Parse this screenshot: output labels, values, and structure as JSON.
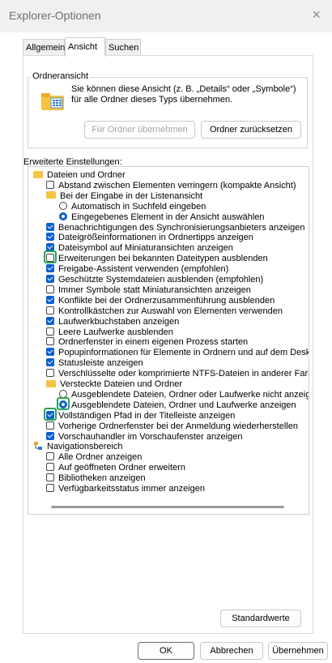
{
  "window": {
    "title": "Explorer-Optionen",
    "close_symbol": "×"
  },
  "tabs": [
    {
      "label": "Allgemein",
      "active": false
    },
    {
      "label": "Ansicht",
      "active": true
    },
    {
      "label": "Suchen",
      "active": false
    }
  ],
  "folder_view": {
    "legend": "Ordneransicht",
    "description": "Sie können diese Ansicht (z. B. „Details“ oder „Symbole“) für alle Ordner dieses Typs übernehmen.",
    "apply_label": "Für Ordner übernehmen",
    "reset_label": "Ordner zurücksetzen"
  },
  "advanced": {
    "label": "Erweiterte Einstellungen:",
    "items": [
      {
        "kind": "folder",
        "level": 0,
        "label": "Dateien und Ordner"
      },
      {
        "kind": "checkbox",
        "level": 1,
        "checked": false,
        "label": "Abstand zwischen Elementen verringern (kompakte Ansicht)"
      },
      {
        "kind": "folder",
        "level": 1,
        "label": "Bei der Eingabe in der Listenansicht"
      },
      {
        "kind": "radio",
        "level": 2,
        "checked": false,
        "label": "Automatisch in Suchfeld eingeben"
      },
      {
        "kind": "radio",
        "level": 2,
        "checked": true,
        "label": "Eingegebenes Element in der Ansicht auswählen"
      },
      {
        "kind": "checkbox",
        "level": 1,
        "checked": true,
        "label": "Benachrichtigungen des Synchronisierungsanbieters anzeigen"
      },
      {
        "kind": "checkbox",
        "level": 1,
        "checked": true,
        "label": "Dateigrößeinformationen in Ordnertipps anzeigen"
      },
      {
        "kind": "checkbox",
        "level": 1,
        "checked": true,
        "label": "Dateisymbol auf Miniaturansichten anzeigen"
      },
      {
        "kind": "checkbox",
        "level": 1,
        "checked": false,
        "label": "Erweiterungen bei bekannten Dateitypen ausblenden",
        "highlight": true
      },
      {
        "kind": "checkbox",
        "level": 1,
        "checked": true,
        "label": "Freigabe-Assistent verwenden (empfohlen)"
      },
      {
        "kind": "checkbox",
        "level": 1,
        "checked": true,
        "label": "Geschützte Systemdateien ausblenden (empfohlen)"
      },
      {
        "kind": "checkbox",
        "level": 1,
        "checked": false,
        "label": "Immer Symbole statt Miniaturansichten anzeigen"
      },
      {
        "kind": "checkbox",
        "level": 1,
        "checked": true,
        "label": "Konflikte bei der Ordnerzusammenführung ausblenden"
      },
      {
        "kind": "checkbox",
        "level": 1,
        "checked": false,
        "label": "Kontrollkästchen zur Auswahl von Elementen verwenden"
      },
      {
        "kind": "checkbox",
        "level": 1,
        "checked": true,
        "label": "Laufwerkbuchstaben anzeigen"
      },
      {
        "kind": "checkbox",
        "level": 1,
        "checked": false,
        "label": "Leere Laufwerke ausblenden"
      },
      {
        "kind": "checkbox",
        "level": 1,
        "checked": false,
        "label": "Ordnerfenster in einem eigenen Prozess starten"
      },
      {
        "kind": "checkbox",
        "level": 1,
        "checked": true,
        "label": "Popupinformationen für Elemente in Ordnern und auf dem Desktop anzeigen"
      },
      {
        "kind": "checkbox",
        "level": 1,
        "checked": true,
        "label": "Statusleiste anzeigen"
      },
      {
        "kind": "checkbox",
        "level": 1,
        "checked": false,
        "label": "Verschlüsselte oder komprimierte NTFS-Dateien in anderer Farbe anzeigen"
      },
      {
        "kind": "folder",
        "level": 1,
        "label": "Versteckte Dateien und Ordner"
      },
      {
        "kind": "radio",
        "level": 2,
        "checked": false,
        "label": "Ausgeblendete Dateien, Ordner oder Laufwerke nicht anzeigen"
      },
      {
        "kind": "radio",
        "level": 2,
        "checked": true,
        "label": "Ausgeblendete Dateien, Ordner und Laufwerke anzeigen",
        "highlight": true
      },
      {
        "kind": "checkbox",
        "level": 1,
        "checked": true,
        "label": "Vollständigen Pfad in der Titelleiste anzeigen",
        "highlight": true
      },
      {
        "kind": "checkbox",
        "level": 1,
        "checked": false,
        "label": "Vorherige Ordnerfenster bei der Anmeldung wiederherstellen"
      },
      {
        "kind": "checkbox",
        "level": 1,
        "checked": true,
        "label": "Vorschauhandler im Vorschaufenster anzeigen"
      },
      {
        "kind": "nav",
        "level": 0,
        "label": "Navigationsbereich"
      },
      {
        "kind": "checkbox",
        "level": 1,
        "checked": false,
        "label": "Alle Ordner anzeigen"
      },
      {
        "kind": "checkbox",
        "level": 1,
        "checked": false,
        "label": "Auf geöffneten Ordner erweitern"
      },
      {
        "kind": "checkbox",
        "level": 1,
        "checked": false,
        "label": "Bibliotheken anzeigen"
      },
      {
        "kind": "checkbox",
        "level": 1,
        "checked": false,
        "label": "Verfügbarkeitsstatus immer anzeigen"
      }
    ]
  },
  "buttons": {
    "defaults_label": "Standardwerte",
    "ok_label": "OK",
    "cancel_label": "Abbrechen",
    "apply_label": "Übernehmen"
  },
  "colors": {
    "accent": "#0a5fd1",
    "highlight": "#29a35a",
    "folder": "#f6c343"
  }
}
